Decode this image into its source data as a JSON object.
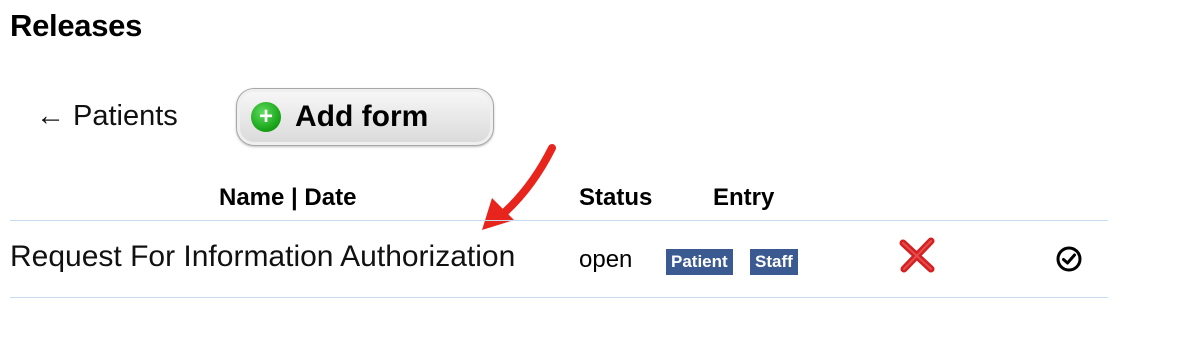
{
  "page": {
    "title": "Releases"
  },
  "nav": {
    "back_arrow": "←",
    "back_label": "Patients"
  },
  "toolbar": {
    "add_form_icon": "+",
    "add_form_label": "Add form"
  },
  "table": {
    "headers": {
      "name_date": "Name | Date",
      "status": "Status",
      "entry": "Entry"
    },
    "rows": [
      {
        "name": "Request For Information Authorization",
        "status": "open",
        "entry_badges": [
          "Patient",
          "Staff"
        ],
        "delete_icon": "red-x-icon",
        "complete_icon": "check-circle-icon"
      }
    ]
  },
  "colors": {
    "badge": "#3a5a91",
    "rule": "#c9dcef",
    "delete": "#d42020",
    "annotation_arrow": "#e8251c",
    "add_icon": "#14a014"
  }
}
